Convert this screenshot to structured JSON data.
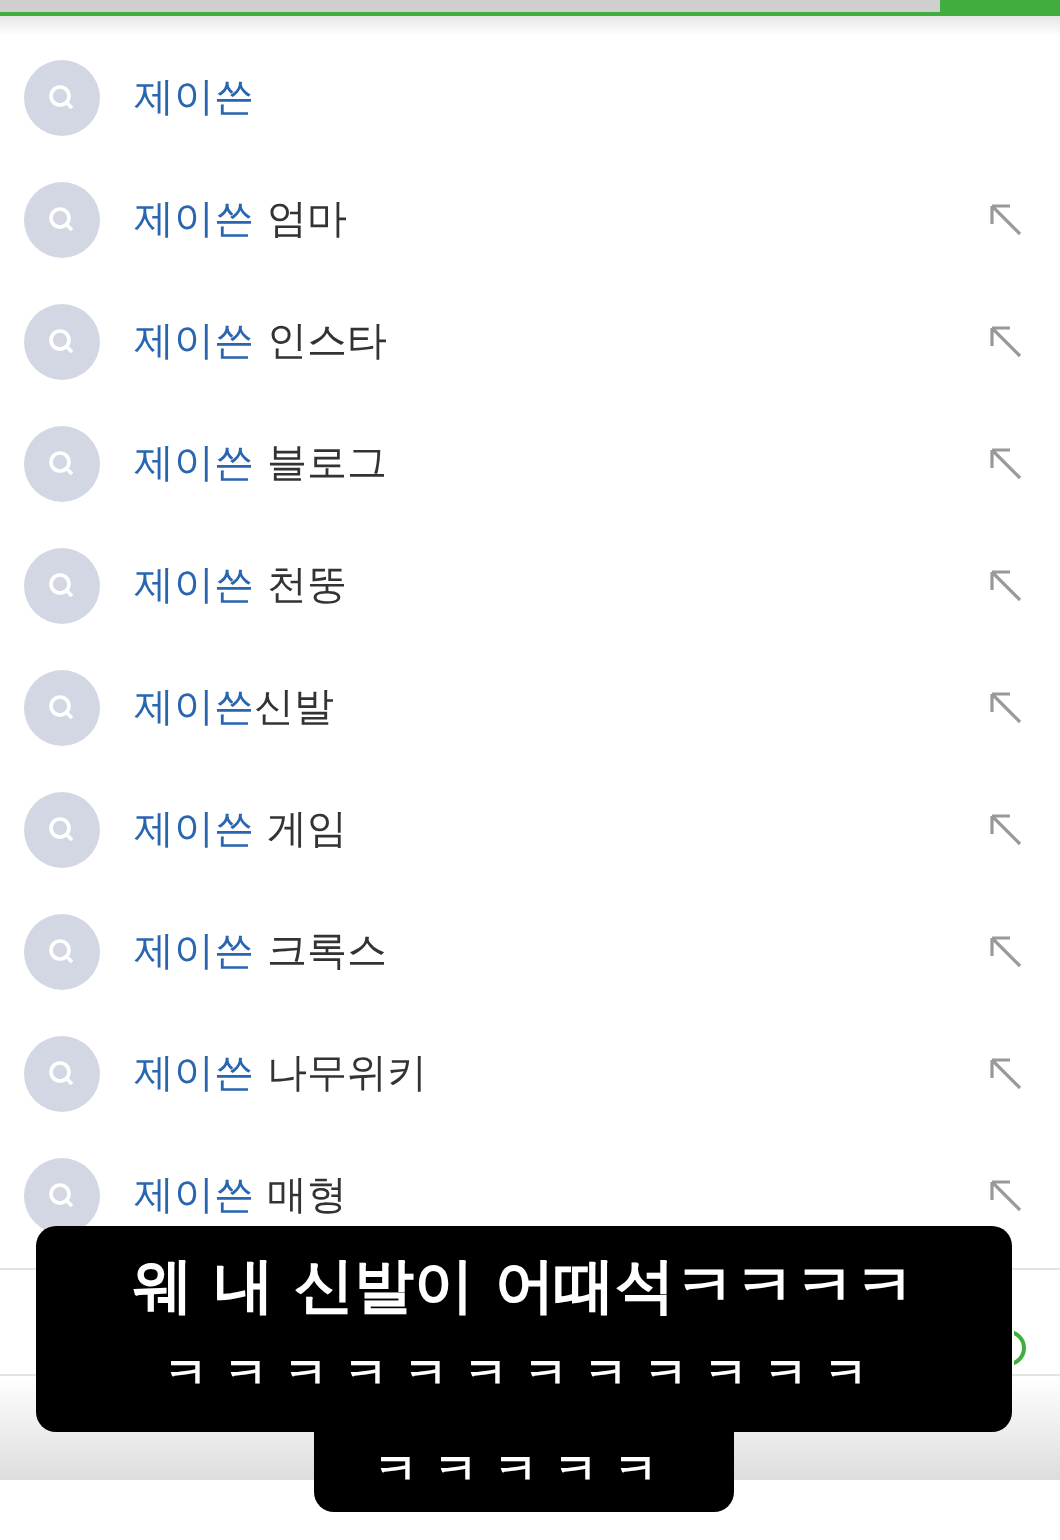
{
  "suggestions": [
    {
      "match": "제이쓴",
      "arrow": false
    },
    {
      "match": "제이쓴",
      "rest": " 엄마",
      "arrow": true
    },
    {
      "match": "제이쓴",
      "rest": " 인스타",
      "arrow": true
    },
    {
      "match": "제이쓴",
      "rest": " 블로그",
      "arrow": true
    },
    {
      "match": "제이쓴",
      "rest": " 천뚱",
      "arrow": true
    },
    {
      "match": "제이쓴",
      "rest": "신발",
      "arrow": true
    },
    {
      "match": "제이쓴",
      "rest": " 게임",
      "arrow": true
    },
    {
      "match": "제이쓴",
      "rest": " 크록스",
      "arrow": true
    },
    {
      "match": "제이쓴",
      "rest": " 나무위키",
      "arrow": true
    },
    {
      "match": "제이쓴",
      "rest": " 매형",
      "arrow": true
    }
  ],
  "caption": {
    "lines": [
      "웨 내 신발이 어때석ㅋㅋㅋㅋ",
      "ㅋㅋㅋㅋㅋㅋㅋㅋㅋㅋㅋㅋ",
      "ㅋㅋㅋㅋㅋ"
    ]
  }
}
